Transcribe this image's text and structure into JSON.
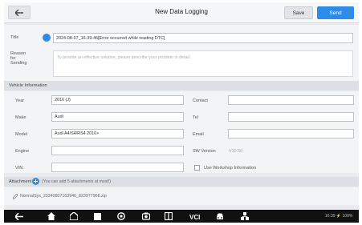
{
  "header": {
    "title": "New Data Logging",
    "save_label": "Save",
    "send_label": "Send"
  },
  "form": {
    "title_label": "Title",
    "title_value": "2024-08-07_16-39-46[Error occurred while reading DTC]",
    "reason_label": "Reason\nfor\nSending",
    "reason_placeholder": "To provide an effective solution, please describe your problem in detail."
  },
  "vehicle": {
    "section_label": "Vehicle Information",
    "year_label": "Year",
    "year_value": "2016 (J)",
    "make_label": "Make",
    "make_value": "Audi",
    "model_label": "Model",
    "model_value": "Audi A4/S4/RS4 2016>",
    "engine_label": "Engine",
    "engine_value": "",
    "vin_label": "VIN",
    "vin_value": "",
    "contact_label": "Contact",
    "contact_value": "",
    "tel_label": "Tel",
    "tel_value": "",
    "email_label": "Email",
    "email_value": "",
    "sw_version_label": "SW Version",
    "sw_version_value": "V10.50",
    "workshop_label": "Use Workshop Information"
  },
  "attachment": {
    "label": "Attachment",
    "hint": "(You can add 5 attachments at most!)",
    "file_name": "NormalSys_20240807163946_823977968.zip"
  },
  "status_bar": {
    "text": "16:39 ⚡ 100%"
  },
  "colors": {
    "accent": "#2f8be8",
    "background": "#e9ebee",
    "nav_bar": "#111111"
  }
}
